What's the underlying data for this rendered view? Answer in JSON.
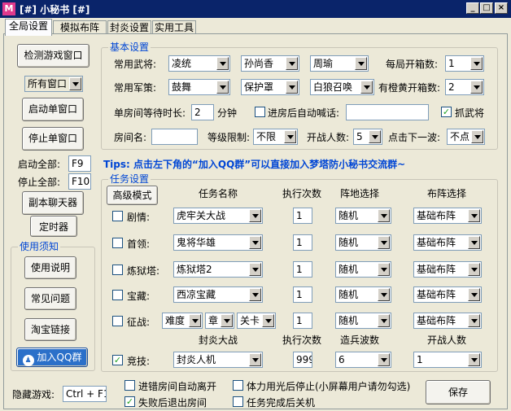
{
  "window": {
    "logo": "M",
    "title": "[#]  小秘书  [#]",
    "controls": [
      "_",
      "□",
      "×"
    ]
  },
  "tabs": [
    "全局设置",
    "模拟布阵",
    "封炎设置",
    "实用工具"
  ],
  "left": {
    "detect_btn": "检测游戏窗口",
    "window_select": "所有窗口",
    "start_single_btn": "启动单窗口",
    "stop_single_btn": "停止单窗口",
    "start_all_label": "启动全部:",
    "start_all_key": "F9",
    "stop_all_label": "停止全部:",
    "stop_all_key": "F10",
    "chat_btn": "副本聊天器",
    "timer_btn": "定时器",
    "notice_legend": "使用须知",
    "manual_btn": "使用说明",
    "faq_btn": "常见问题",
    "taobao_btn": "淘宝链接",
    "qq_btn": "加入QQ群",
    "hide_label": "隐藏游戏:",
    "hide_key": "Ctrl + F1"
  },
  "basic": {
    "legend": "基本设置",
    "generals_label": "常用武将:",
    "generals": [
      "凌统",
      "孙尚香",
      "周瑜"
    ],
    "box_label": "每局开箱数:",
    "box_value": "1",
    "strategy_label": "常用军策:",
    "strategies": [
      "鼓舞",
      "保护罩",
      "白狼召唤"
    ],
    "yellow_box_label": "有橙黄开箱数:",
    "yellow_box_value": "2",
    "wait_label": "单房间等待时长:",
    "wait_value": "2",
    "wait_unit": "分钟",
    "auto_shout_label": "进房后自动喊话:",
    "auto_shout_value": "",
    "catch_general_label": "抓武将",
    "room_label": "房间名:",
    "room_value": "",
    "level_label": "等级限制:",
    "level_value": "不限",
    "players_label": "开战人数:",
    "players_value": "5",
    "next_wave_label": "点击下一波:",
    "next_wave_value": "不点"
  },
  "tips": "Tips: 点击左下角的“加入QQ群”可以直接加入梦塔防小秘书交流群~",
  "tasks": {
    "legend": "任务设置",
    "advanced_btn": "高级模式",
    "headers": [
      "任务名称",
      "执行次数",
      "阵地选择",
      "布阵选择"
    ],
    "rows": [
      {
        "label": "剧情:",
        "task": "虎牢关大战",
        "count": "1",
        "position": "随机",
        "formation": "基础布阵"
      },
      {
        "label": "首领:",
        "task": "鬼将华雄",
        "count": "1",
        "position": "随机",
        "formation": "基础布阵"
      },
      {
        "label": "炼狱塔:",
        "task": "炼狱塔2",
        "count": "1",
        "position": "随机",
        "formation": "基础布阵"
      },
      {
        "label": "宝藏:",
        "task": "西凉宝藏",
        "count": "1",
        "position": "随机",
        "formation": "基础布阵"
      }
    ],
    "conquest": {
      "label": "征战:",
      "difficulty": "难度",
      "chapter": "章",
      "stage": "关卡",
      "count": "1",
      "position": "随机",
      "formation": "基础布阵"
    },
    "headers2": [
      "封炎大战",
      "执行次数",
      "造兵波数",
      "开战人数"
    ],
    "arena": {
      "label": "竞技:",
      "task": "封炎人机",
      "count": "999",
      "waves": "6",
      "players": "1"
    }
  },
  "bottom": {
    "opt1": "进错房间自动离开",
    "opt2": "体力用光后停止(小屏幕用户请勿勾选)",
    "opt3": "失败后退出房间",
    "opt4": "任务完成后关机",
    "save_btn": "保存"
  }
}
